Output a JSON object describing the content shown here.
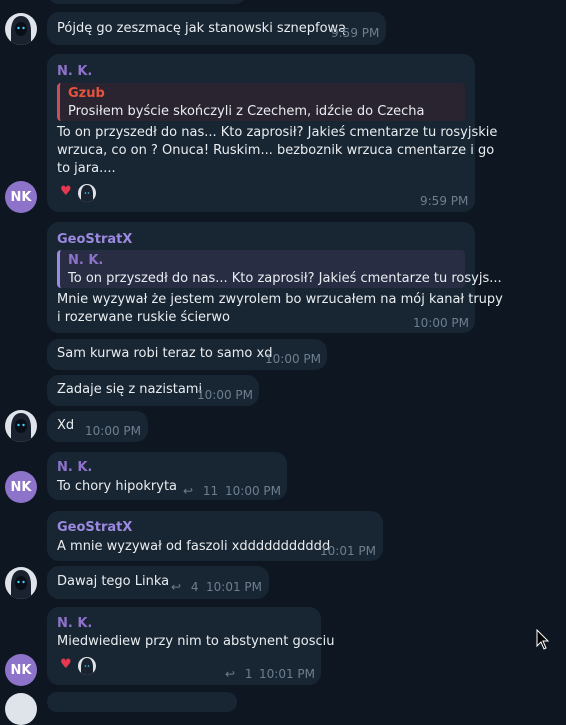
{
  "messages": [
    {
      "text": "Pójdę go zeszmacę jak stanowski sznepfową",
      "time": "9:59 PM"
    },
    {
      "sender": "N. K.",
      "quote_sender": "Gzub",
      "quote_text": "Prosiłem byście skończyli z Czechem, idźcie do Czecha",
      "lines": [
        "To on przyszedł do nas... Kto zaprosił? Jakieś cmentarze tu rosyjskie",
        "wrzuca,  co on ? Onuca!  Ruskim... bezboznik wrzuca cmentarze i go",
        "to jara...."
      ],
      "time": "9:59 PM"
    },
    {
      "sender": "GeoStratX",
      "quote_sender": "N. K.",
      "quote_text": "To on przyszedł do nas... Kto zaprosił? Jakieś cmentarze tu rosyjs...",
      "lines": [
        "Mnie wyzywał że jestem zwyrolem bo wrzucałem na mój kanał trupy",
        "i rozerwane ruskie ścierwo"
      ],
      "time": "10:00 PM"
    },
    {
      "text": "Sam kurwa robi teraz to samo xd",
      "time": "10:00 PM"
    },
    {
      "text": "Zadaje się z nazistami",
      "time": "10:00 PM"
    },
    {
      "text": "Xd",
      "time": "10:00 PM"
    },
    {
      "sender": "N. K.",
      "text": "To chory hipokryta",
      "replies": "11",
      "time": "10:00 PM"
    },
    {
      "sender": "GeoStratX",
      "text": "A mnie wyzywał od faszoli xddddddddddd",
      "time": "10:01 PM"
    },
    {
      "text": "Dawaj tego Linka",
      "replies": "4",
      "time": "10:01 PM"
    },
    {
      "sender": "N. K.",
      "text": "Miedwiediew przy nim to abstynent gosciu",
      "replies": "1",
      "time": "10:01 PM"
    }
  ],
  "avatars": {
    "nk_initials": "NK"
  },
  "reactions": {
    "heart": "♥"
  },
  "icons": {
    "reply": "reply-arrow-icon"
  },
  "colors": {
    "nk": "#8d73c9",
    "gzub": "#e5533d",
    "geostratx": "#9b8ae0"
  }
}
